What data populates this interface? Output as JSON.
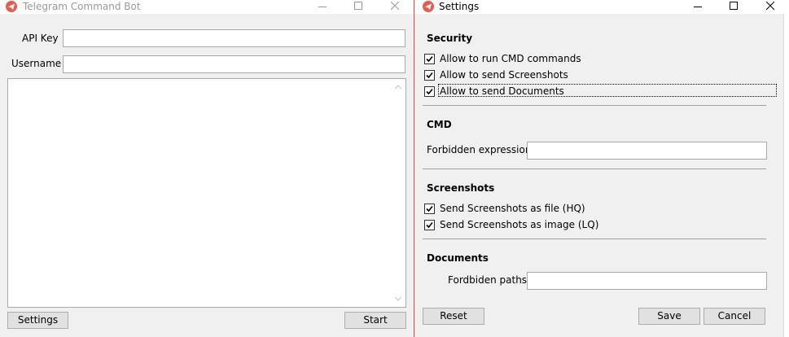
{
  "main_window": {
    "title": "Telegram Command Bot",
    "api_key_label": "API Key",
    "username_label": "Username",
    "api_key_value": "",
    "username_value": "",
    "settings_button": "Settings",
    "start_button": "Start"
  },
  "settings_window": {
    "title": "Settings",
    "security": {
      "heading": "Security",
      "options": [
        {
          "label": "Allow to run CMD commands",
          "checked": true
        },
        {
          "label": "Allow to send Screenshots",
          "checked": true
        },
        {
          "label": "Allow to send Documents",
          "checked": true
        }
      ]
    },
    "cmd": {
      "heading": "CMD",
      "forbidden_label": "Forbidden expressions",
      "forbidden_value": ""
    },
    "screenshots": {
      "heading": "Screenshots",
      "options": [
        {
          "label": "Send Screenshots as file (HQ)",
          "checked": true
        },
        {
          "label": "Send Screenshots as image (LQ)",
          "checked": true
        }
      ]
    },
    "documents": {
      "heading": "Documents",
      "paths_label": "Fordbiden paths",
      "paths_value": ""
    },
    "reset_button": "Reset",
    "save_button": "Save",
    "cancel_button": "Cancel"
  },
  "icons": {
    "app_icon": "telegram-icon",
    "minimize": "minimize-icon",
    "maximize": "maximize-icon",
    "close": "close-icon",
    "checkmark": "checkmark-icon"
  },
  "colors": {
    "icon_red": "#ea5b4f",
    "active_border": "#e8403a",
    "inactive_title_text": "#999999"
  }
}
